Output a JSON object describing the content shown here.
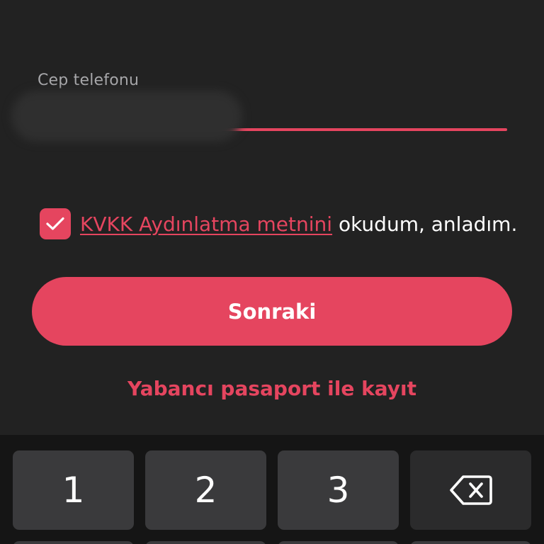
{
  "form": {
    "phone_label": "Cep telefonu",
    "phone_value": ""
  },
  "consent": {
    "checked": true,
    "link_text": "KVKK Aydınlatma metnini",
    "suffix_text": " okudum, anladım."
  },
  "actions": {
    "next_label": "Sonraki",
    "passport_label": "Yabancı pasaport ile kayıt"
  },
  "keypad": {
    "keys": [
      "1",
      "2",
      "3"
    ],
    "backspace_icon": "backspace-icon"
  },
  "colors": {
    "accent": "#e5455f",
    "background": "#222222",
    "keypad_background": "#151515",
    "key": "#3a3a3c"
  }
}
